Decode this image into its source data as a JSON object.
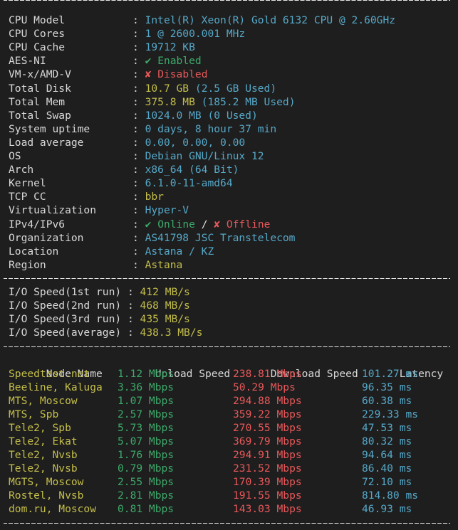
{
  "system_info": [
    {
      "label": "CPU Model",
      "value": "Intel(R) Xeon(R) Gold 6132 CPU @ 2.60GHz",
      "color": "cyan"
    },
    {
      "label": "CPU Cores",
      "value": "1 @ 2600.001 MHz",
      "color": "cyan"
    },
    {
      "label": "CPU Cache",
      "value": "19712 KB",
      "color": "cyan"
    },
    {
      "label": "AES-NI",
      "icon": "✔",
      "value": "Enabled",
      "color": "green"
    },
    {
      "label": "VM-x/AMD-V",
      "icon": "✘",
      "value": "Disabled",
      "color": "red"
    },
    {
      "label": "Total Disk",
      "value": "10.7 GB",
      "extra": "(2.5 GB Used)",
      "color": "yellow"
    },
    {
      "label": "Total Mem",
      "value": "375.8 MB",
      "extra": "(185.2 MB Used)",
      "color": "yellow"
    },
    {
      "label": "Total Swap",
      "value": "1024.0 MB (0 Used)",
      "color": "cyan"
    },
    {
      "label": "System uptime",
      "value": "0 days, 8 hour 37 min",
      "color": "cyan"
    },
    {
      "label": "Load average",
      "value": "0.00, 0.00, 0.00",
      "color": "cyan"
    },
    {
      "label": "OS",
      "value": "Debian GNU/Linux 12",
      "color": "cyan"
    },
    {
      "label": "Arch",
      "value": "x86_64 (64 Bit)",
      "color": "cyan"
    },
    {
      "label": "Kernel",
      "value": "6.1.0-11-amd64",
      "color": "cyan"
    },
    {
      "label": "TCP CC",
      "value": "bbr",
      "color": "yellow"
    },
    {
      "label": "Virtualization",
      "value": "Hyper-V",
      "color": "cyan"
    },
    {
      "label": "IPv4/IPv6",
      "ipv4_icon": "✔",
      "ipv4": "Online",
      "slash": "/",
      "ipv6_icon": "✘",
      "ipv6": "Offline"
    },
    {
      "label": "Organization",
      "value": "AS41798 JSC Transtelecom",
      "color": "cyan"
    },
    {
      "label": "Location",
      "value": "Astana / KZ",
      "color": "cyan"
    },
    {
      "label": "Region",
      "value": "Astana",
      "color": "yellow"
    }
  ],
  "colon": ":",
  "separator": "----------------------------------------------------------------------",
  "io": [
    {
      "label": "I/O Speed(1st run)",
      "value": "412 MB/s"
    },
    {
      "label": "I/O Speed(2nd run)",
      "value": "468 MB/s"
    },
    {
      "label": "I/O Speed(3rd run)",
      "value": "435 MB/s"
    },
    {
      "label": "I/O Speed(average)",
      "value": "438.3 MB/s"
    }
  ],
  "speedtest": {
    "headers": [
      "Node Name",
      "Upload Speed",
      "Download Speed",
      "Latency"
    ],
    "rows": [
      {
        "node": "Speedtest.net",
        "upload": "1.12 Mbps",
        "download": "238.81 Mbps",
        "latency": "101.27 ms"
      },
      {
        "node": "Beeline, Kaluga",
        "upload": "3.36 Mbps",
        "download": "50.29 Mbps",
        "latency": "96.35 ms"
      },
      {
        "node": "MTS, Moscow",
        "upload": "1.07 Mbps",
        "download": "294.88 Mbps",
        "latency": "60.38 ms"
      },
      {
        "node": "MTS, Spb",
        "upload": "2.57 Mbps",
        "download": "359.22 Mbps",
        "latency": "229.33 ms"
      },
      {
        "node": "Tele2, Spb",
        "upload": "5.73 Mbps",
        "download": "270.55 Mbps",
        "latency": "47.53 ms"
      },
      {
        "node": "Tele2, Ekat",
        "upload": "5.07 Mbps",
        "download": "369.79 Mbps",
        "latency": "80.32 ms"
      },
      {
        "node": "Tele2, Nvsb",
        "upload": "1.76 Mbps",
        "download": "294.91 Mbps",
        "latency": "94.64 ms"
      },
      {
        "node": "Tele2, Nvsb",
        "upload": "0.79 Mbps",
        "download": "231.52 Mbps",
        "latency": "86.40 ms"
      },
      {
        "node": "MGTS, Moscow",
        "upload": "2.55 Mbps",
        "download": "170.39 Mbps",
        "latency": "72.10 ms"
      },
      {
        "node": "Rostel, Nvsb",
        "upload": "2.81 Mbps",
        "download": "191.55 Mbps",
        "latency": "814.80 ms"
      },
      {
        "node": "dom.ru, Moscow",
        "upload": "0.81 Mbps",
        "download": "143.03 Mbps",
        "latency": "46.93 ms"
      }
    ]
  },
  "colors": {
    "background": "#1e1e1e",
    "text": "#d8d8d8",
    "cyan": "#56a8c8",
    "green": "#3daa6a",
    "red": "#e8585a",
    "yellow": "#c4be4a"
  }
}
